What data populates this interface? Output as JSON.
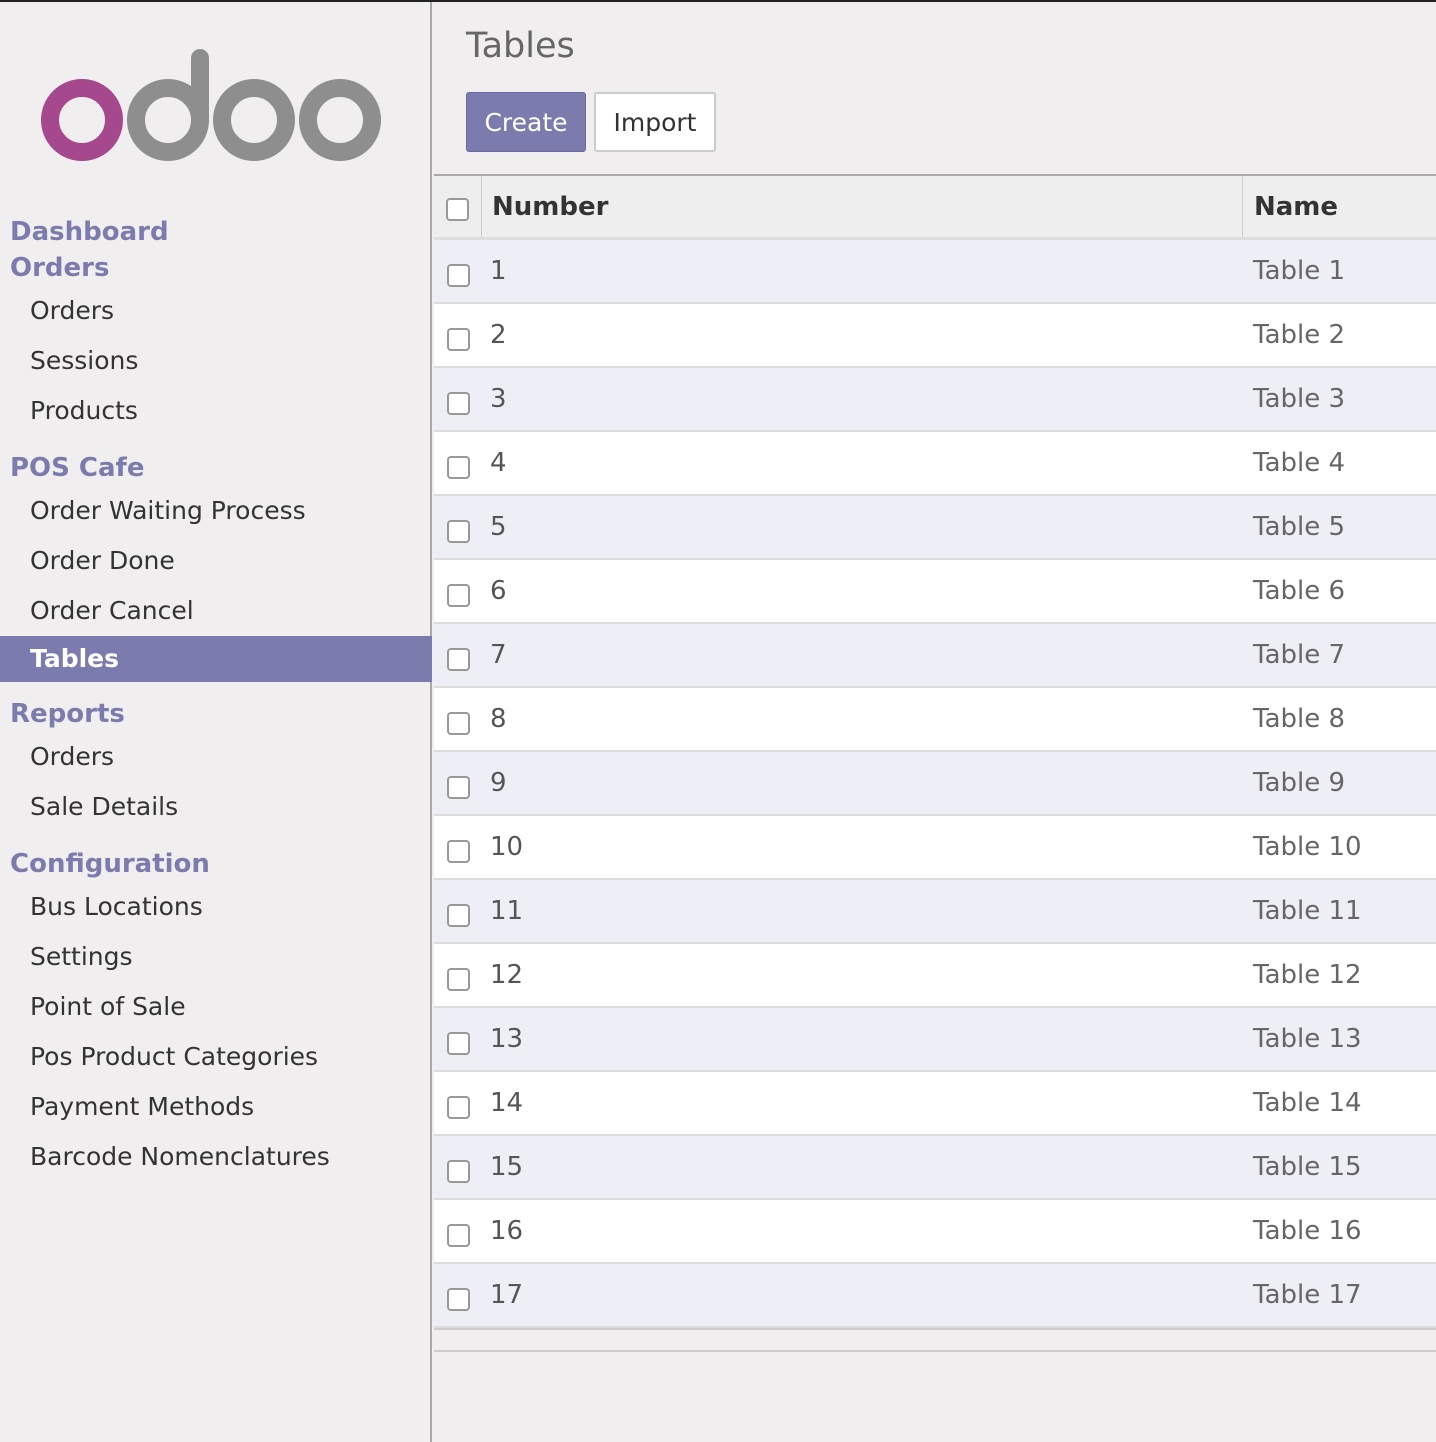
{
  "brand": {
    "logo_text": "odoo",
    "logo_colors": [
      "#a5488e",
      "#8e8e8e"
    ]
  },
  "accent_color": "#7c7bad",
  "sidebar": {
    "sections": [
      {
        "label": "Dashboard",
        "items": []
      },
      {
        "label": "Orders",
        "items": [
          "Orders",
          "Sessions",
          "Products"
        ]
      },
      {
        "label": "POS Cafe",
        "items": [
          "Order Waiting Process",
          "Order Done",
          "Order Cancel",
          "Tables"
        ]
      },
      {
        "label": "Reports",
        "items": [
          "Orders",
          "Sale Details"
        ]
      },
      {
        "label": "Configuration",
        "items": [
          "Bus Locations",
          "Settings",
          "Point of Sale",
          "Pos Product Categories",
          "Payment Methods",
          "Barcode Nomenclatures"
        ]
      }
    ],
    "active_item": "Tables"
  },
  "main": {
    "title": "Tables",
    "buttons": {
      "create": "Create",
      "import": "Import"
    },
    "table": {
      "columns": [
        "Number",
        "Name"
      ],
      "rows": [
        [
          "1",
          "Table 1"
        ],
        [
          "2",
          "Table 2"
        ],
        [
          "3",
          "Table 3"
        ],
        [
          "4",
          "Table 4"
        ],
        [
          "5",
          "Table 5"
        ],
        [
          "6",
          "Table 6"
        ],
        [
          "7",
          "Table 7"
        ],
        [
          "8",
          "Table 8"
        ],
        [
          "9",
          "Table 9"
        ],
        [
          "10",
          "Table 10"
        ],
        [
          "11",
          "Table 11"
        ],
        [
          "12",
          "Table 12"
        ],
        [
          "13",
          "Table 13"
        ],
        [
          "14",
          "Table 14"
        ],
        [
          "15",
          "Table 15"
        ],
        [
          "16",
          "Table 16"
        ],
        [
          "17",
          "Table 17"
        ]
      ]
    }
  }
}
